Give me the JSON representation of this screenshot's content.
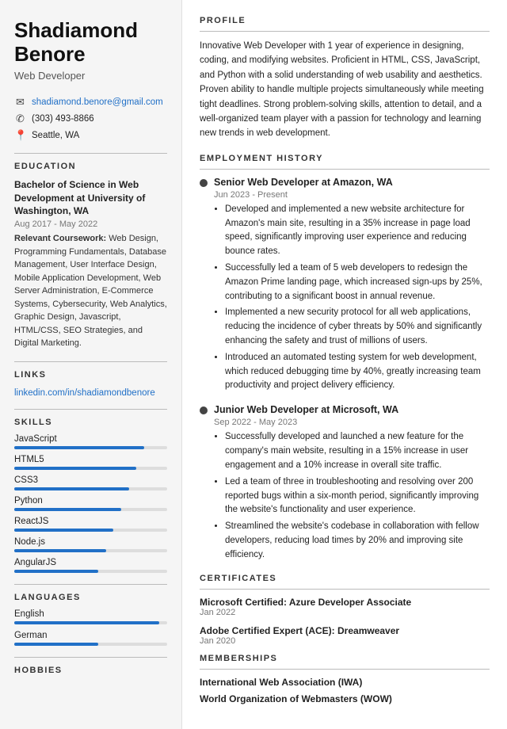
{
  "sidebar": {
    "name": "Shadiamond Benore",
    "title": "Web Developer",
    "contact": {
      "email": "shadiamond.benore@gmail.com",
      "phone": "(303) 493-8866",
      "location": "Seattle, WA"
    },
    "education": {
      "degree": "Bachelor of Science in Web Development at University of Washington, WA",
      "dates": "Aug 2017 - May 2022",
      "coursework_label": "Relevant Coursework:",
      "coursework": "Web Design, Programming Fundamentals, Database Management, User Interface Design, Mobile Application Development, Web Server Administration, E-Commerce Systems, Cybersecurity, Web Analytics, Graphic Design, Javascript, HTML/CSS, SEO Strategies, and Digital Marketing."
    },
    "links": {
      "label": "Links",
      "linkedin": "linkedin.com/in/shadiamondbenore"
    },
    "skills": {
      "label": "Skills",
      "items": [
        {
          "name": "JavaScript",
          "pct": 85
        },
        {
          "name": "HTML5",
          "pct": 80
        },
        {
          "name": "CSS3",
          "pct": 75
        },
        {
          "name": "Python",
          "pct": 70
        },
        {
          "name": "ReactJS",
          "pct": 65
        },
        {
          "name": "Node.js",
          "pct": 60
        },
        {
          "name": "AngularJS",
          "pct": 55
        }
      ]
    },
    "languages": {
      "label": "Languages",
      "items": [
        {
          "name": "English",
          "pct": 95
        },
        {
          "name": "German",
          "pct": 55
        }
      ]
    },
    "hobbies": {
      "label": "Hobbies"
    }
  },
  "main": {
    "profile": {
      "label": "Profile",
      "text": "Innovative Web Developer with 1 year of experience in designing, coding, and modifying websites. Proficient in HTML, CSS, JavaScript, and Python with a solid understanding of web usability and aesthetics. Proven ability to handle multiple projects simultaneously while meeting tight deadlines. Strong problem-solving skills, attention to detail, and a well-organized team player with a passion for technology and learning new trends in web development."
    },
    "employment": {
      "label": "Employment History",
      "jobs": [
        {
          "title": "Senior Web Developer at Amazon, WA",
          "dates": "Jun 2023 - Present",
          "bullets": [
            "Developed and implemented a new website architecture for Amazon's main site, resulting in a 35% increase in page load speed, significantly improving user experience and reducing bounce rates.",
            "Successfully led a team of 5 web developers to redesign the Amazon Prime landing page, which increased sign-ups by 25%, contributing to a significant boost in annual revenue.",
            "Implemented a new security protocol for all web applications, reducing the incidence of cyber threats by 50% and significantly enhancing the safety and trust of millions of users.",
            "Introduced an automated testing system for web development, which reduced debugging time by 40%, greatly increasing team productivity and project delivery efficiency."
          ]
        },
        {
          "title": "Junior Web Developer at Microsoft, WA",
          "dates": "Sep 2022 - May 2023",
          "bullets": [
            "Successfully developed and launched a new feature for the company's main website, resulting in a 15% increase in user engagement and a 10% increase in overall site traffic.",
            "Led a team of three in troubleshooting and resolving over 200 reported bugs within a six-month period, significantly improving the website's functionality and user experience.",
            "Streamlined the website's codebase in collaboration with fellow developers, reducing load times by 20% and improving site efficiency."
          ]
        }
      ]
    },
    "certificates": {
      "label": "Certificates",
      "items": [
        {
          "name": "Microsoft Certified: Azure Developer Associate",
          "date": "Jan 2022"
        },
        {
          "name": "Adobe Certified Expert (ACE): Dreamweaver",
          "date": "Jan 2020"
        }
      ]
    },
    "memberships": {
      "label": "Memberships",
      "items": [
        "International Web Association (IWA)",
        "World Organization of Webmasters (WOW)"
      ]
    }
  }
}
